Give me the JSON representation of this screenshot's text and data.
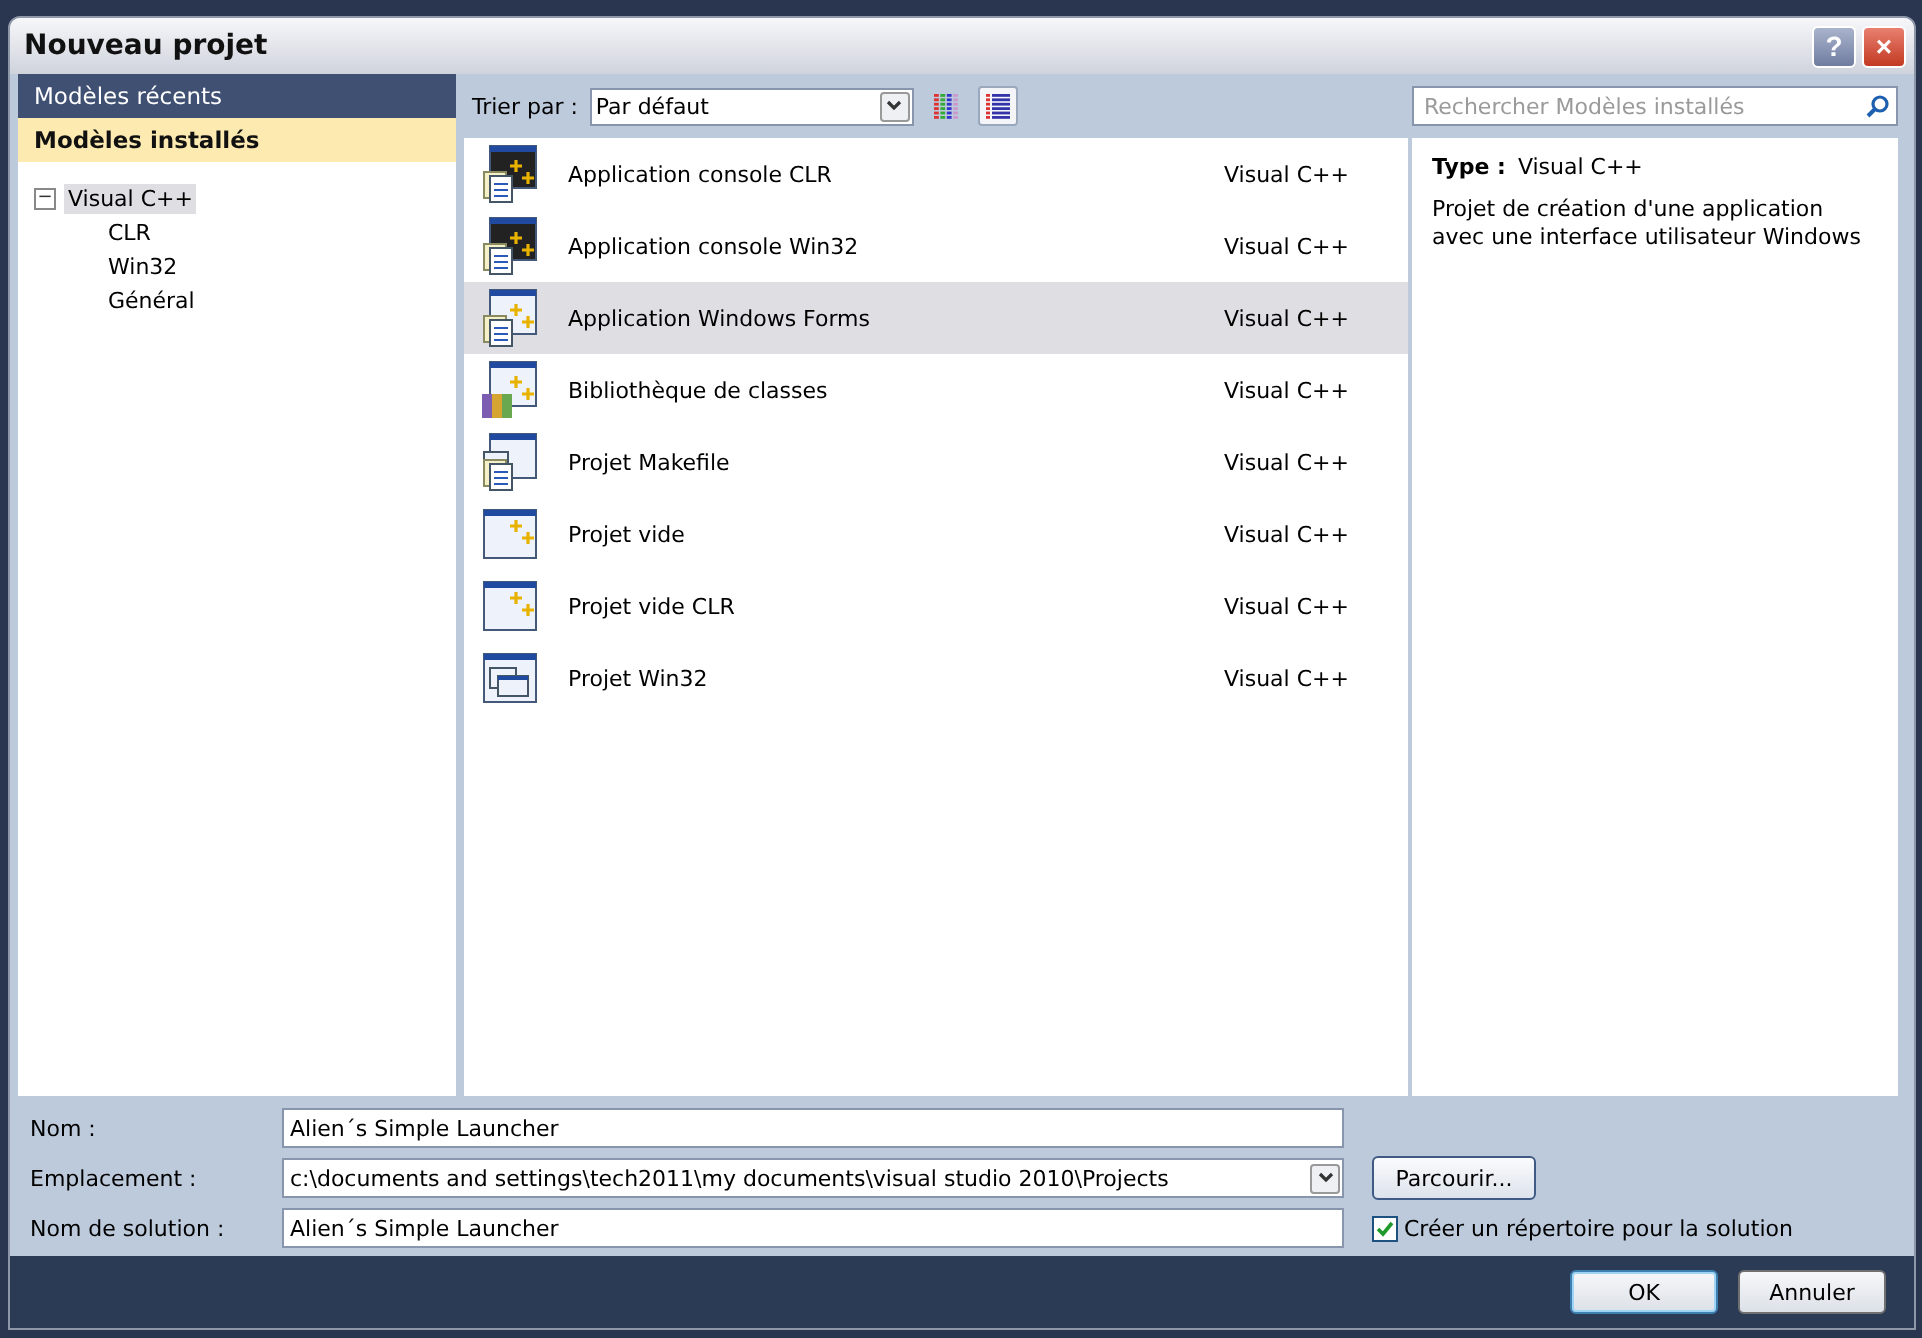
{
  "window": {
    "title": "Nouveau projet",
    "help_button": "?",
    "close_button": "×"
  },
  "sidebar": {
    "sections": [
      {
        "label": "Modèles récents",
        "selected": false
      },
      {
        "label": "Modèles installés",
        "selected": true
      }
    ],
    "tree": [
      {
        "label": "Visual C++",
        "expanded": true,
        "toggle": "−",
        "selected": true,
        "children": [
          {
            "label": "CLR",
            "selected": false
          },
          {
            "label": "Win32",
            "selected": false
          },
          {
            "label": "Général",
            "selected": false
          }
        ]
      }
    ]
  },
  "toolbar": {
    "sort_label": "Trier par :",
    "sort_value": "Par défaut",
    "views": [
      {
        "kind": "grid",
        "selected": false
      },
      {
        "kind": "list",
        "selected": true
      }
    ],
    "search": {
      "placeholder": "Rechercher Modèles installés"
    }
  },
  "templates": [
    {
      "name": "Application console CLR",
      "type": "Visual C++",
      "kind": "console",
      "selected": false
    },
    {
      "name": "Application console Win32",
      "type": "Visual C++",
      "kind": "console",
      "selected": false
    },
    {
      "name": "Application Windows Forms",
      "type": "Visual C++",
      "kind": "forms",
      "selected": true
    },
    {
      "name": "Bibliothèque de classes",
      "type": "Visual C++",
      "kind": "library",
      "selected": false
    },
    {
      "name": "Projet Makefile",
      "type": "Visual C++",
      "kind": "makefile",
      "selected": false
    },
    {
      "name": "Projet vide",
      "type": "Visual C++",
      "kind": "empty",
      "selected": false
    },
    {
      "name": "Projet vide CLR",
      "type": "Visual C++",
      "kind": "empty",
      "selected": false
    },
    {
      "name": "Projet Win32",
      "type": "Visual C++",
      "kind": "win32",
      "selected": false
    }
  ],
  "details": {
    "type_label": "Type :",
    "type_value": "Visual C++",
    "description": "Projet de création d'une application avec une interface utilisateur Windows"
  },
  "form": {
    "fields": [
      {
        "label": "Nom :",
        "value": "Alien´s Simple Launcher",
        "kind": "text"
      },
      {
        "label": "Emplacement :",
        "value": "c:\\documents and settings\\tech2011\\my documents\\visual studio 2010\\Projects",
        "kind": "combo",
        "button": "Parcourir..."
      },
      {
        "label": "Nom de solution :",
        "value": "Alien´s Simple Launcher",
        "kind": "check",
        "check_label": "Créer un répertoire pour la solution",
        "checked": true
      }
    ]
  },
  "buttons": [
    {
      "label": "OK",
      "default": true
    },
    {
      "label": "Annuler",
      "default": false
    }
  ]
}
